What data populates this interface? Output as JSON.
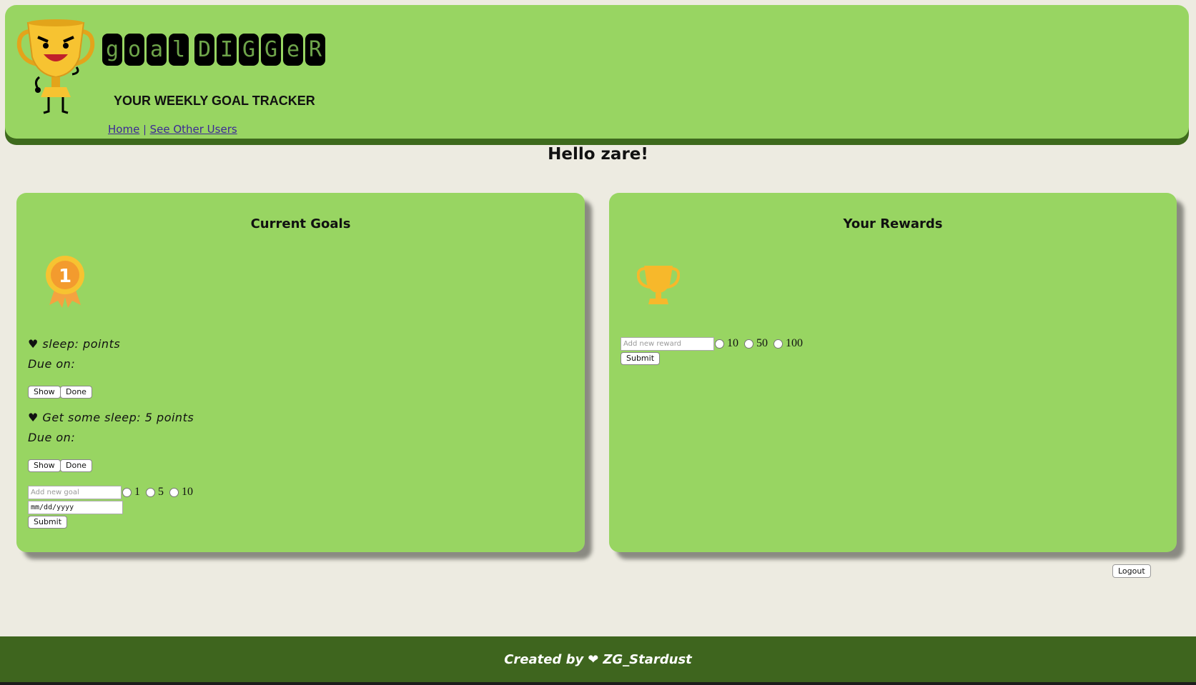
{
  "header": {
    "brand_words": [
      "GOAL",
      "DIGGER"
    ],
    "tagline": "YOUR WEEKLY GOAL TRACKER",
    "nav": {
      "home": "Home",
      "separator": "|",
      "other_users": "See Other Users"
    }
  },
  "greeting": "Hello zare!",
  "goals_panel": {
    "title": "Current Goals",
    "goals": [
      {
        "text": "♥ sleep: points",
        "due": "Due on:",
        "show_label": "Show",
        "done_label": "Done"
      },
      {
        "text": "♥ Get some sleep: 5 points",
        "due": "Due on:",
        "show_label": "Show",
        "done_label": "Done"
      }
    ],
    "new_goal": {
      "placeholder": "Add new goal",
      "point_options": [
        "1",
        "5",
        "10"
      ],
      "date_placeholder": "mm/dd/yyyy",
      "submit_label": "Submit"
    }
  },
  "rewards_panel": {
    "title": "Your Rewards",
    "new_reward": {
      "placeholder": "Add new reward",
      "point_options": [
        "10",
        "50",
        "100"
      ],
      "submit_label": "Submit"
    }
  },
  "logout_label": "Logout",
  "footer": {
    "prefix": "Created by",
    "heart": "❤",
    "author": "ZG_Stardust"
  },
  "colors": {
    "header_bg": "#98d562",
    "header_shadow": "#3e6a1d",
    "page_bg": "#edebe1",
    "footer_bg": "#3e651e",
    "nav_link": "#3c2896"
  }
}
